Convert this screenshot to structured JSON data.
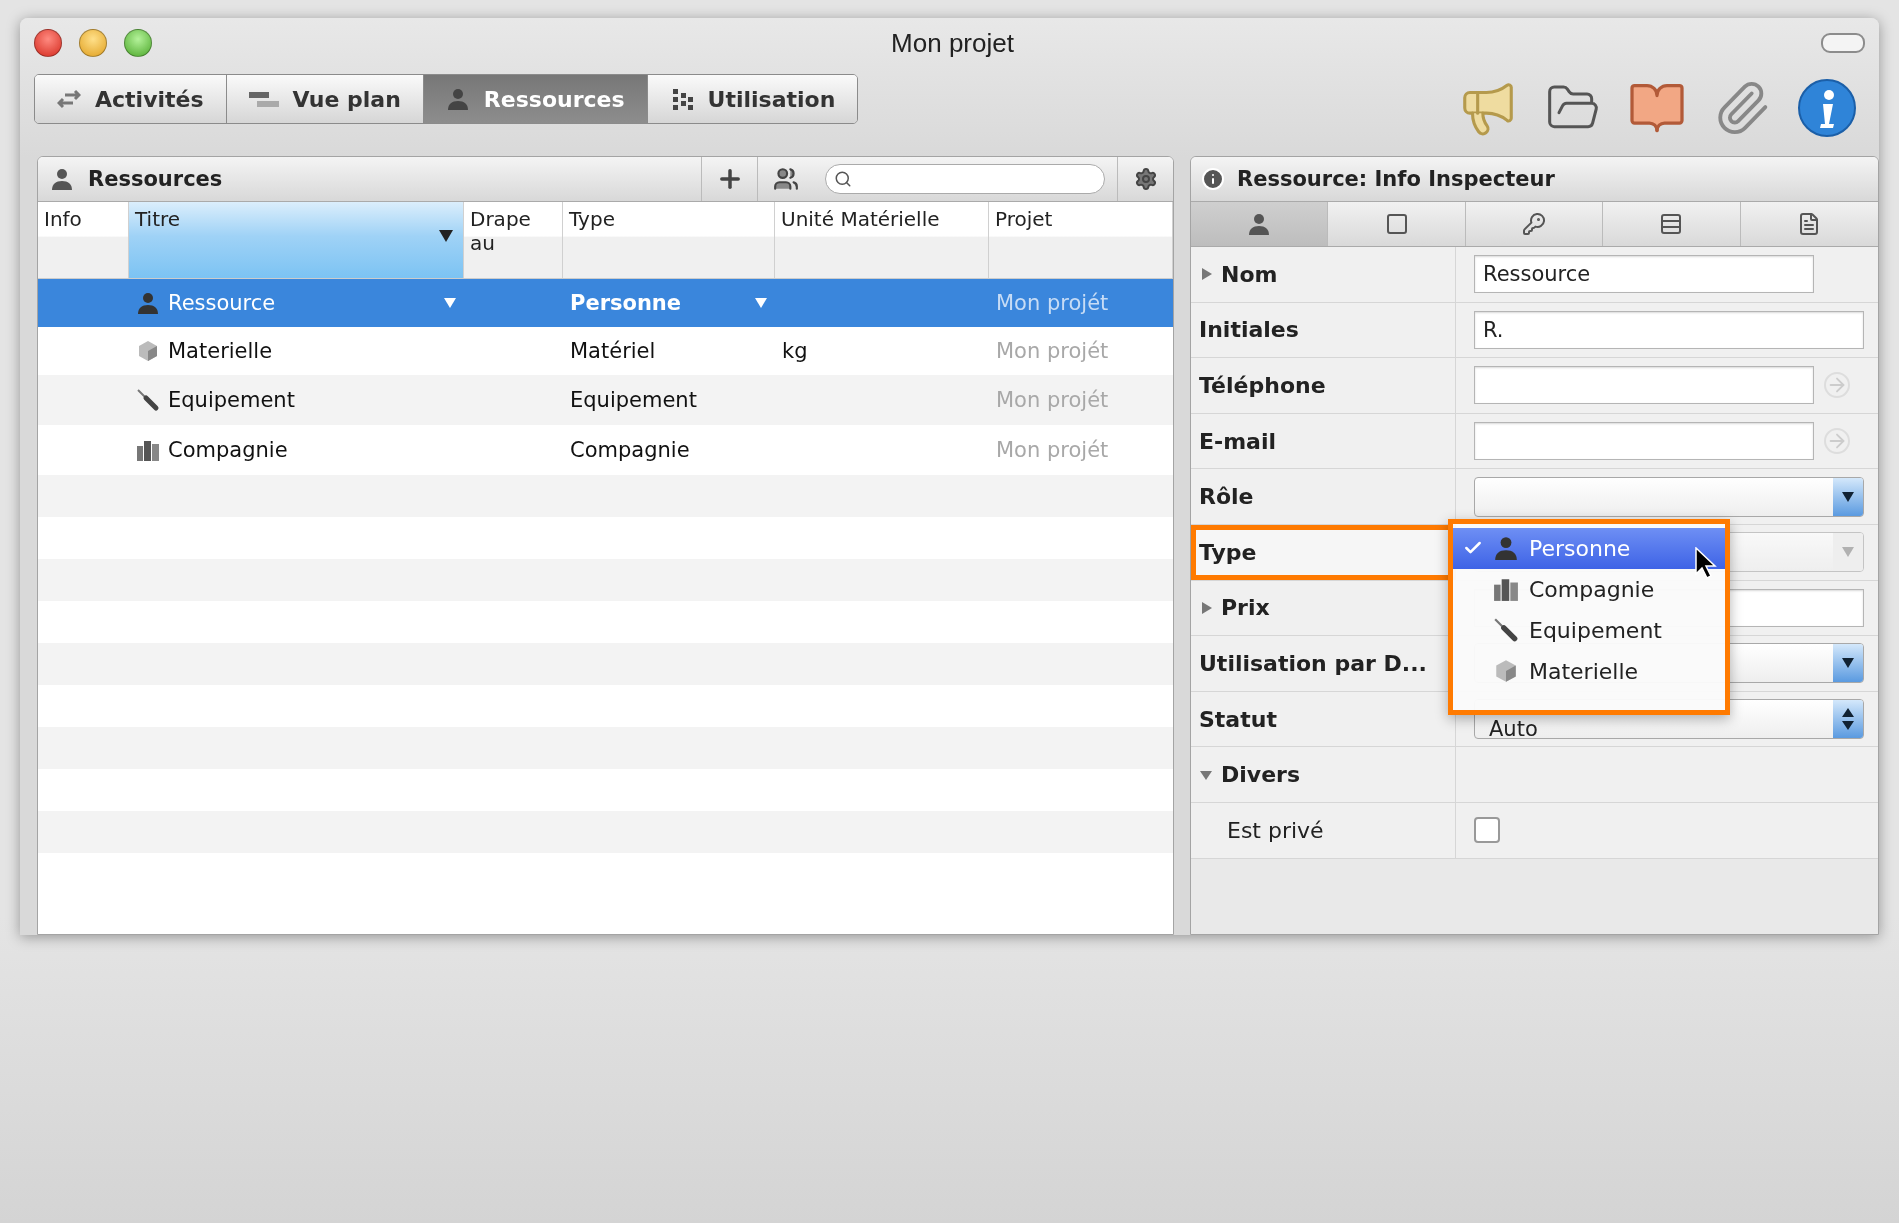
{
  "window": {
    "title": "Mon projet"
  },
  "tabs": [
    {
      "label": "Activités",
      "selected": false
    },
    {
      "label": "Vue plan",
      "selected": false
    },
    {
      "label": "Ressources",
      "selected": true
    },
    {
      "label": "Utilisation",
      "selected": false
    }
  ],
  "resources": {
    "title": "Ressources",
    "columns": [
      {
        "label": "Info",
        "sorted": false
      },
      {
        "label": "Titre",
        "sorted": true
      },
      {
        "label": "Drape au",
        "sorted": false
      },
      {
        "label": "Type",
        "sorted": false
      },
      {
        "label": "Unité Matérielle",
        "sorted": false
      },
      {
        "label": "Projet",
        "sorted": false
      }
    ],
    "rows": [
      {
        "title": "Ressource",
        "kind": "person",
        "type": "Personne",
        "project": "Mon projét",
        "selected": true
      },
      {
        "title": "Materielle",
        "kind": "material",
        "type": "Matériel",
        "unit": "kg",
        "project": "Mon projét",
        "selected": false
      },
      {
        "title": "Equipement",
        "kind": "equipment",
        "type": "Equipement",
        "project": "Mon projét",
        "selected": false
      },
      {
        "title": "Compagnie",
        "kind": "company",
        "type": "Compagnie",
        "project": "Mon projét",
        "selected": false
      }
    ]
  },
  "inspector": {
    "title": "Ressource: Info Inspecteur",
    "tabs": [
      {
        "selected": true
      },
      {
        "selected": false
      },
      {
        "selected": false
      },
      {
        "selected": false
      },
      {
        "selected": false
      }
    ],
    "rows": [
      {
        "kind": "text",
        "label": "Nom",
        "expanded": false,
        "value": "Ressource",
        "action": false
      },
      {
        "kind": "text",
        "label": "Initiales",
        "value": "R.",
        "action": false
      },
      {
        "kind": "text",
        "label": "Téléphone",
        "value": "",
        "action": true
      },
      {
        "kind": "text",
        "label": "E-mail",
        "value": "",
        "action": true
      },
      {
        "kind": "select",
        "label": "Rôle"
      },
      {
        "kind": "menu",
        "label": "Type",
        "highlighted": true,
        "menu": [
          {
            "label": "Personne",
            "kind": "person",
            "selected": true
          },
          {
            "label": "Compagnie",
            "kind": "company",
            "selected": false
          },
          {
            "label": "Equipement",
            "kind": "equipment",
            "selected": false
          },
          {
            "label": "Materielle",
            "kind": "material",
            "selected": false
          }
        ]
      },
      {
        "kind": "text",
        "label": "Prix",
        "expanded": false,
        "value": "",
        "action": false
      },
      {
        "kind": "select",
        "label": "Utilisation par D..."
      },
      {
        "kind": "stepper",
        "label": "Statut",
        "value": "Auto"
      },
      {
        "kind": "section",
        "label": "Divers",
        "expanded": true
      },
      {
        "kind": "checkbox",
        "label": "Est privé",
        "checked": false
      }
    ]
  }
}
